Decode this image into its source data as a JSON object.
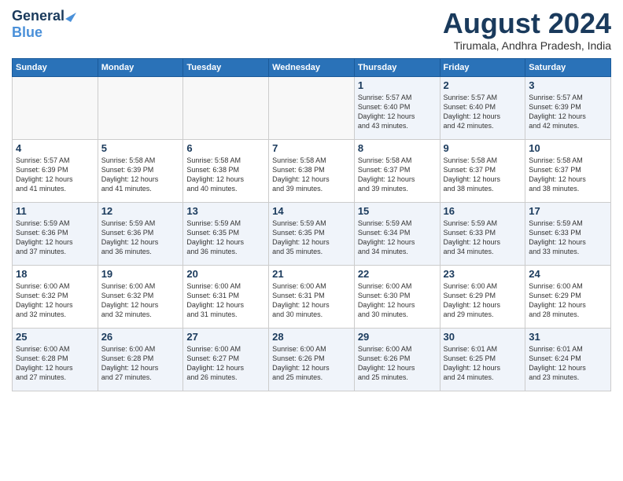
{
  "header": {
    "logo_line1": "General",
    "logo_line2": "Blue",
    "month_year": "August 2024",
    "location": "Tirumala, Andhra Pradesh, India"
  },
  "weekdays": [
    "Sunday",
    "Monday",
    "Tuesday",
    "Wednesday",
    "Thursday",
    "Friday",
    "Saturday"
  ],
  "weeks": [
    [
      {
        "day": "",
        "info": ""
      },
      {
        "day": "",
        "info": ""
      },
      {
        "day": "",
        "info": ""
      },
      {
        "day": "",
        "info": ""
      },
      {
        "day": "1",
        "info": "Sunrise: 5:57 AM\nSunset: 6:40 PM\nDaylight: 12 hours\nand 43 minutes."
      },
      {
        "day": "2",
        "info": "Sunrise: 5:57 AM\nSunset: 6:40 PM\nDaylight: 12 hours\nand 42 minutes."
      },
      {
        "day": "3",
        "info": "Sunrise: 5:57 AM\nSunset: 6:39 PM\nDaylight: 12 hours\nand 42 minutes."
      }
    ],
    [
      {
        "day": "4",
        "info": "Sunrise: 5:57 AM\nSunset: 6:39 PM\nDaylight: 12 hours\nand 41 minutes."
      },
      {
        "day": "5",
        "info": "Sunrise: 5:58 AM\nSunset: 6:39 PM\nDaylight: 12 hours\nand 41 minutes."
      },
      {
        "day": "6",
        "info": "Sunrise: 5:58 AM\nSunset: 6:38 PM\nDaylight: 12 hours\nand 40 minutes."
      },
      {
        "day": "7",
        "info": "Sunrise: 5:58 AM\nSunset: 6:38 PM\nDaylight: 12 hours\nand 39 minutes."
      },
      {
        "day": "8",
        "info": "Sunrise: 5:58 AM\nSunset: 6:37 PM\nDaylight: 12 hours\nand 39 minutes."
      },
      {
        "day": "9",
        "info": "Sunrise: 5:58 AM\nSunset: 6:37 PM\nDaylight: 12 hours\nand 38 minutes."
      },
      {
        "day": "10",
        "info": "Sunrise: 5:58 AM\nSunset: 6:37 PM\nDaylight: 12 hours\nand 38 minutes."
      }
    ],
    [
      {
        "day": "11",
        "info": "Sunrise: 5:59 AM\nSunset: 6:36 PM\nDaylight: 12 hours\nand 37 minutes."
      },
      {
        "day": "12",
        "info": "Sunrise: 5:59 AM\nSunset: 6:36 PM\nDaylight: 12 hours\nand 36 minutes."
      },
      {
        "day": "13",
        "info": "Sunrise: 5:59 AM\nSunset: 6:35 PM\nDaylight: 12 hours\nand 36 minutes."
      },
      {
        "day": "14",
        "info": "Sunrise: 5:59 AM\nSunset: 6:35 PM\nDaylight: 12 hours\nand 35 minutes."
      },
      {
        "day": "15",
        "info": "Sunrise: 5:59 AM\nSunset: 6:34 PM\nDaylight: 12 hours\nand 34 minutes."
      },
      {
        "day": "16",
        "info": "Sunrise: 5:59 AM\nSunset: 6:33 PM\nDaylight: 12 hours\nand 34 minutes."
      },
      {
        "day": "17",
        "info": "Sunrise: 5:59 AM\nSunset: 6:33 PM\nDaylight: 12 hours\nand 33 minutes."
      }
    ],
    [
      {
        "day": "18",
        "info": "Sunrise: 6:00 AM\nSunset: 6:32 PM\nDaylight: 12 hours\nand 32 minutes."
      },
      {
        "day": "19",
        "info": "Sunrise: 6:00 AM\nSunset: 6:32 PM\nDaylight: 12 hours\nand 32 minutes."
      },
      {
        "day": "20",
        "info": "Sunrise: 6:00 AM\nSunset: 6:31 PM\nDaylight: 12 hours\nand 31 minutes."
      },
      {
        "day": "21",
        "info": "Sunrise: 6:00 AM\nSunset: 6:31 PM\nDaylight: 12 hours\nand 30 minutes."
      },
      {
        "day": "22",
        "info": "Sunrise: 6:00 AM\nSunset: 6:30 PM\nDaylight: 12 hours\nand 30 minutes."
      },
      {
        "day": "23",
        "info": "Sunrise: 6:00 AM\nSunset: 6:29 PM\nDaylight: 12 hours\nand 29 minutes."
      },
      {
        "day": "24",
        "info": "Sunrise: 6:00 AM\nSunset: 6:29 PM\nDaylight: 12 hours\nand 28 minutes."
      }
    ],
    [
      {
        "day": "25",
        "info": "Sunrise: 6:00 AM\nSunset: 6:28 PM\nDaylight: 12 hours\nand 27 minutes."
      },
      {
        "day": "26",
        "info": "Sunrise: 6:00 AM\nSunset: 6:28 PM\nDaylight: 12 hours\nand 27 minutes."
      },
      {
        "day": "27",
        "info": "Sunrise: 6:00 AM\nSunset: 6:27 PM\nDaylight: 12 hours\nand 26 minutes."
      },
      {
        "day": "28",
        "info": "Sunrise: 6:00 AM\nSunset: 6:26 PM\nDaylight: 12 hours\nand 25 minutes."
      },
      {
        "day": "29",
        "info": "Sunrise: 6:00 AM\nSunset: 6:26 PM\nDaylight: 12 hours\nand 25 minutes."
      },
      {
        "day": "30",
        "info": "Sunrise: 6:01 AM\nSunset: 6:25 PM\nDaylight: 12 hours\nand 24 minutes."
      },
      {
        "day": "31",
        "info": "Sunrise: 6:01 AM\nSunset: 6:24 PM\nDaylight: 12 hours\nand 23 minutes."
      }
    ]
  ]
}
